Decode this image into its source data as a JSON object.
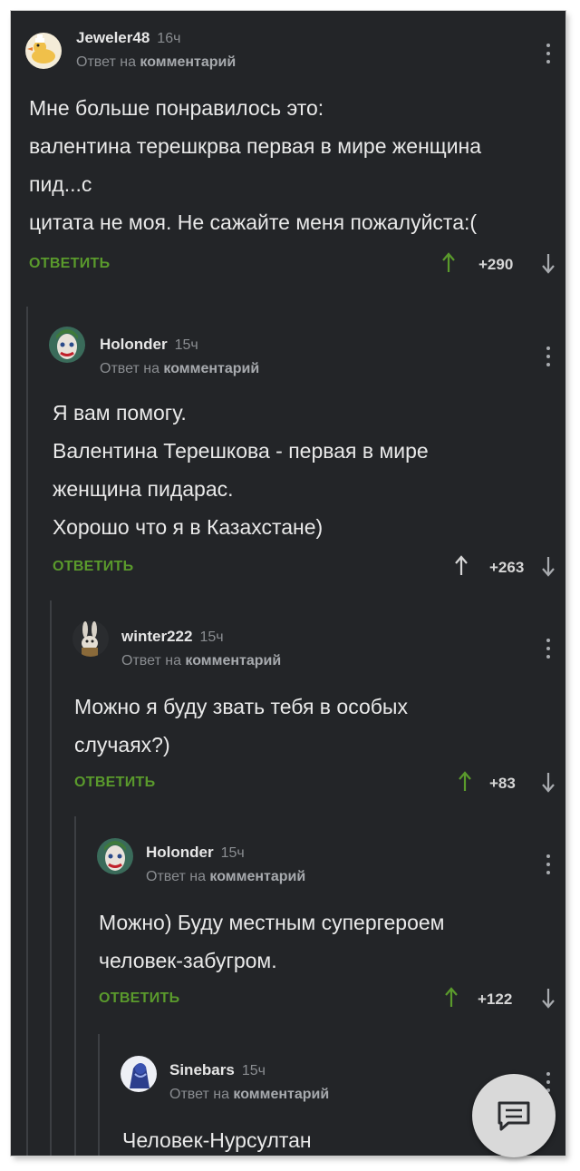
{
  "reply_prefix": "Ответ на",
  "reply_target": "комментарий",
  "reply_label": "ОТВЕТИТЬ",
  "colors": {
    "background": "#232528",
    "text": "#e9e9e9",
    "accent_reply": "#5a9a2c",
    "vote_up": "#5a9a2c",
    "vote_down": "#a8abaf"
  },
  "comments": [
    {
      "author": "Jeweler48",
      "time": "16ч",
      "avatar_icon": "duck-avatar-icon",
      "lines": [
        "Мне больше понравилось это:",
        "валентина терешкрва первая в мире женщина",
        "пид...с",
        "цитата не моя. Не сажайте меня пожалуйста:("
      ],
      "score": "+290"
    },
    {
      "author": "Holonder",
      "time": "15ч",
      "avatar_icon": "joker-avatar-icon",
      "lines": [
        "Я вам помогу.",
        "Валентина Терешкова - первая в мире",
        "женщина пидарас.",
        "Хорошо что я в Казахстане)"
      ],
      "score": "+263"
    },
    {
      "author": "winter222",
      "time": "15ч",
      "avatar_icon": "bunny-avatar-icon",
      "lines": [
        "Можно я буду звать тебя в особых",
        "случаях?)"
      ],
      "score": "+83"
    },
    {
      "author": "Holonder",
      "time": "15ч",
      "avatar_icon": "joker-avatar-icon",
      "lines": [
        "Можно) Буду местным супергероем",
        "человек-забугром."
      ],
      "score": "+122"
    },
    {
      "author": "Sinebars",
      "time": "15ч",
      "avatar_icon": "snow-leopard-avatar-icon",
      "lines": [
        "Человек-Нурсултан"
      ],
      "score": ""
    }
  ],
  "fab": {
    "icon": "comment-icon"
  }
}
